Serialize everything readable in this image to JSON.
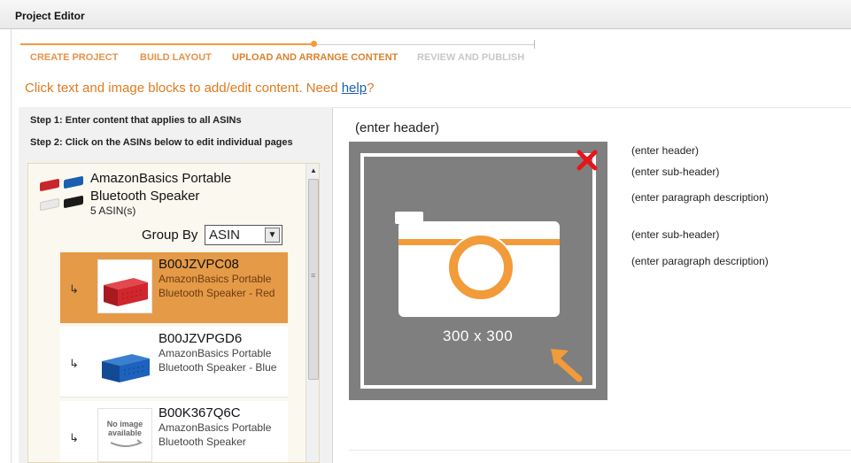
{
  "window": {
    "title": "Project Editor"
  },
  "steps": [
    {
      "label": "CREATE PROJECT",
      "state": "done"
    },
    {
      "label": "BUILD LAYOUT",
      "state": "done"
    },
    {
      "label": "UPLOAD AND ARRANGE CONTENT",
      "state": "active"
    },
    {
      "label": "REVIEW AND PUBLISH",
      "state": "todo"
    }
  ],
  "instructions": {
    "text": "Click text and image blocks to add/edit content. Need ",
    "link": "help",
    "suffix": "?"
  },
  "left": {
    "step1": "Step 1: Enter content that applies to all ASINs",
    "step2": "Step 2: Click on the ASINs below to edit individual pages",
    "product": {
      "name": "AmazonBasics Portable Bluetooth Speaker",
      "count": "5 ASIN(s)"
    },
    "group_by": {
      "label": "Group By",
      "value": "ASIN"
    },
    "items": [
      {
        "asin": "B00JZVPC08",
        "desc": "AmazonBasics Portable Bluetooth Speaker - Red",
        "selected": true,
        "image": "red-speaker"
      },
      {
        "asin": "B00JZVPGD6",
        "desc": "AmazonBasics Portable Bluetooth Speaker - Blue",
        "selected": false,
        "image": "blue-speaker"
      },
      {
        "asin": "B00K367Q6C",
        "desc": "AmazonBasics Portable Bluetooth Speaker",
        "selected": false,
        "image": "no-image-available"
      }
    ],
    "no_image_text": "No image available"
  },
  "right": {
    "module_header": "(enter header)",
    "image_placeholder": "300 x 300",
    "text_blocks": {
      "header": "(enter header)",
      "subheader1": "(enter sub-header)",
      "paragraph1": "(enter paragraph description)",
      "subheader2": "(enter sub-header)",
      "paragraph2": "(enter paragraph description)"
    }
  },
  "colors": {
    "accent": "#e07b1e",
    "selected_item": "#e59a48",
    "placeholder_gray": "#7f7f7f",
    "remove_red": "#e8141b"
  }
}
